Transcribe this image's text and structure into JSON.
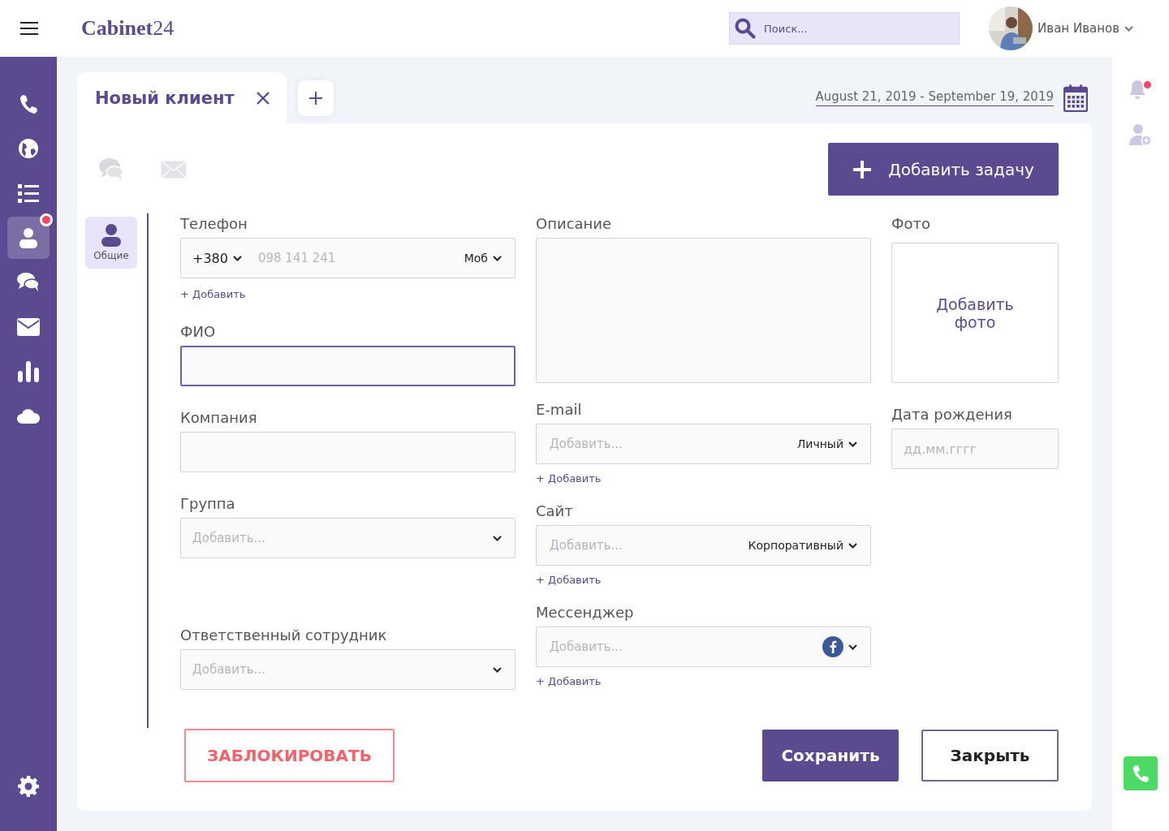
{
  "header": {
    "logo": "**Cabinet**24",
    "search": {
      "placeholder": "Поиск..."
    },
    "user": {
      "name": "Иван Иванов"
    }
  },
  "sidebar": {
    "items": [
      {
        "kind": "phone",
        "selected": false,
        "badge": false
      },
      {
        "kind": "globe",
        "selected": false,
        "badge": false
      },
      {
        "kind": "list",
        "selected": false,
        "badge": false
      },
      {
        "kind": "person",
        "selected": true,
        "badge": true
      },
      {
        "kind": "chat",
        "selected": false,
        "badge": false
      },
      {
        "kind": "mail",
        "selected": false,
        "badge": false
      },
      {
        "kind": "chart",
        "selected": false,
        "badge": false
      },
      {
        "kind": "cloud",
        "selected": false,
        "badge": false
      }
    ]
  },
  "tabs": [
    {
      "label": "Новый клиент",
      "selected": true
    }
  ],
  "date_range": "August 21, 2019 - September 19, 2019",
  "add_task_button": "Добавить задачу",
  "section_tabs": [
    {
      "label": "Общие",
      "selected": true
    }
  ],
  "columns": [
    [
      {
        "kind": "phone",
        "label": "Телефон",
        "code": "+380",
        "placeholder": "098 141 241",
        "type": "Моб",
        "add_link": "+ Добавить"
      },
      {
        "kind": "text",
        "label": "ФИО",
        "focused": true
      },
      {
        "kind": "text",
        "label": "Компания",
        "focused": false
      },
      {
        "kind": "select",
        "label": "Группа",
        "placeholder": "Добавить..."
      },
      {
        "kind": "select",
        "label": "Ответственный сотрудник",
        "placeholder": "Добавить..."
      }
    ],
    [
      {
        "kind": "textarea",
        "label": "Описание"
      },
      {
        "kind": "typed",
        "label": "E-mail",
        "placeholder": "Добавить...",
        "type": "Личный",
        "add_link": "+ Добавить"
      },
      {
        "kind": "typed",
        "label": "Сайт",
        "placeholder": "Добавить...",
        "type": "Корпоративный",
        "add_link": "+ Добавить"
      },
      {
        "kind": "messenger",
        "label": "Мессенджер",
        "placeholder": "Добавить...",
        "add_link": "+ Добавить"
      }
    ],
    [
      {
        "label": "Фото",
        "text": "Добавить фото"
      },
      {
        "kind": "text",
        "label": "Дата рождения",
        "placeholder": "дд.мм.гггг",
        "focused": false
      }
    ]
  ],
  "buttons": {
    "block": "ЗАБЛОКИРОВАТЬ",
    "save": "Сохранить",
    "close": "Закрыть"
  },
  "notifications": {
    "unread": true
  }
}
